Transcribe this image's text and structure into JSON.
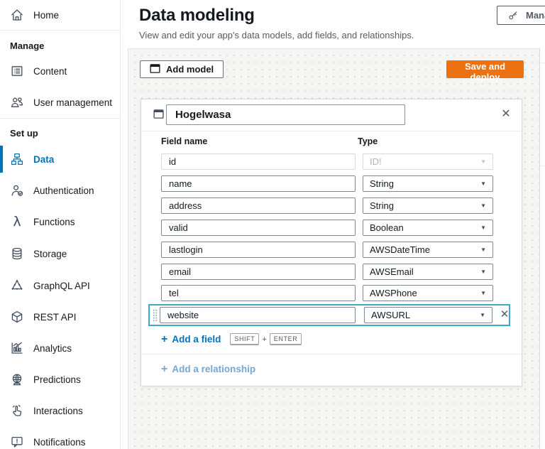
{
  "colors": {
    "accent_blue": "#0073bb",
    "orange": "#ec7211",
    "selection_cyan": "#41a8c8",
    "muted_link": "#74a7d6"
  },
  "sidebar": {
    "entries": [
      {
        "type": "item",
        "label": "Home",
        "icon": "home-icon",
        "selected": false
      },
      {
        "type": "divider"
      },
      {
        "type": "section",
        "label": "Manage"
      },
      {
        "type": "item",
        "label": "Content",
        "icon": "content-icon",
        "selected": false
      },
      {
        "type": "item",
        "label": "User management",
        "icon": "users-icon",
        "selected": false
      },
      {
        "type": "divider"
      },
      {
        "type": "section",
        "label": "Set up"
      },
      {
        "type": "item",
        "label": "Data",
        "icon": "data-icon",
        "selected": true
      },
      {
        "type": "item",
        "label": "Authentication",
        "icon": "authentication-icon",
        "selected": false
      },
      {
        "type": "item",
        "label": "Functions",
        "icon": "lambda-icon",
        "selected": false
      },
      {
        "type": "item",
        "label": "Storage",
        "icon": "storage-icon",
        "selected": false
      },
      {
        "type": "item",
        "label": "GraphQL API",
        "icon": "graphql-icon",
        "selected": false
      },
      {
        "type": "item",
        "label": "REST API",
        "icon": "cube-icon",
        "selected": false
      },
      {
        "type": "item",
        "label": "Analytics",
        "icon": "analytics-icon",
        "selected": false
      },
      {
        "type": "item",
        "label": "Predictions",
        "icon": "predictions-icon",
        "selected": false
      },
      {
        "type": "item",
        "label": "Interactions",
        "icon": "interactions-icon",
        "selected": false
      },
      {
        "type": "item",
        "label": "Notifications",
        "icon": "notifications-icon",
        "selected": false
      }
    ]
  },
  "header": {
    "title": "Data modeling",
    "subtitle": "View and edit your app's data models, add fields, and relationships.",
    "manage_button": "Manage"
  },
  "toolbar": {
    "add_model": "Add model",
    "save_and_deploy": "Save and deploy"
  },
  "model": {
    "name": "Hogelwasa",
    "columns": {
      "field_name": "Field name",
      "type": "Type"
    },
    "fields": [
      {
        "name": "id",
        "type": "ID!",
        "disabled": true,
        "selected": false
      },
      {
        "name": "name",
        "type": "String",
        "disabled": false,
        "selected": false
      },
      {
        "name": "address",
        "type": "String",
        "disabled": false,
        "selected": false
      },
      {
        "name": "valid",
        "type": "Boolean",
        "disabled": false,
        "selected": false
      },
      {
        "name": "lastlogin",
        "type": "AWSDateTime",
        "disabled": false,
        "selected": false
      },
      {
        "name": "email",
        "type": "AWSEmail",
        "disabled": false,
        "selected": false
      },
      {
        "name": "tel",
        "type": "AWSPhone",
        "disabled": false,
        "selected": false
      },
      {
        "name": "website",
        "type": "AWSURL",
        "disabled": false,
        "selected": true
      }
    ],
    "add_field": "Add a field",
    "shortcut_keys": [
      "SHIFT",
      "ENTER"
    ],
    "shortcut_joiner": "+",
    "add_relationship": "Add a relationship"
  }
}
